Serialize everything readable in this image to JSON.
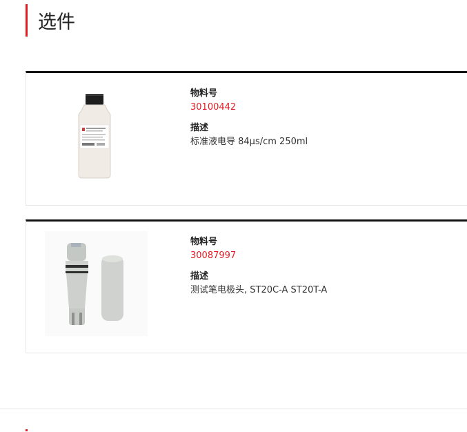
{
  "section": {
    "title": "选件"
  },
  "items": [
    {
      "part_label": "物料号",
      "part_number": "30100442",
      "desc_label": "描述",
      "description": "标准液电导 84μs/cm 250ml"
    },
    {
      "part_label": "物料号",
      "part_number": "30087997",
      "desc_label": "描述",
      "description": "测试笔电极头, ST20C-A ST20T-A"
    }
  ],
  "colors": {
    "accent": "#e31b23",
    "border": "#111111"
  },
  "icons": [
    "bottle-image",
    "electrode-image"
  ]
}
